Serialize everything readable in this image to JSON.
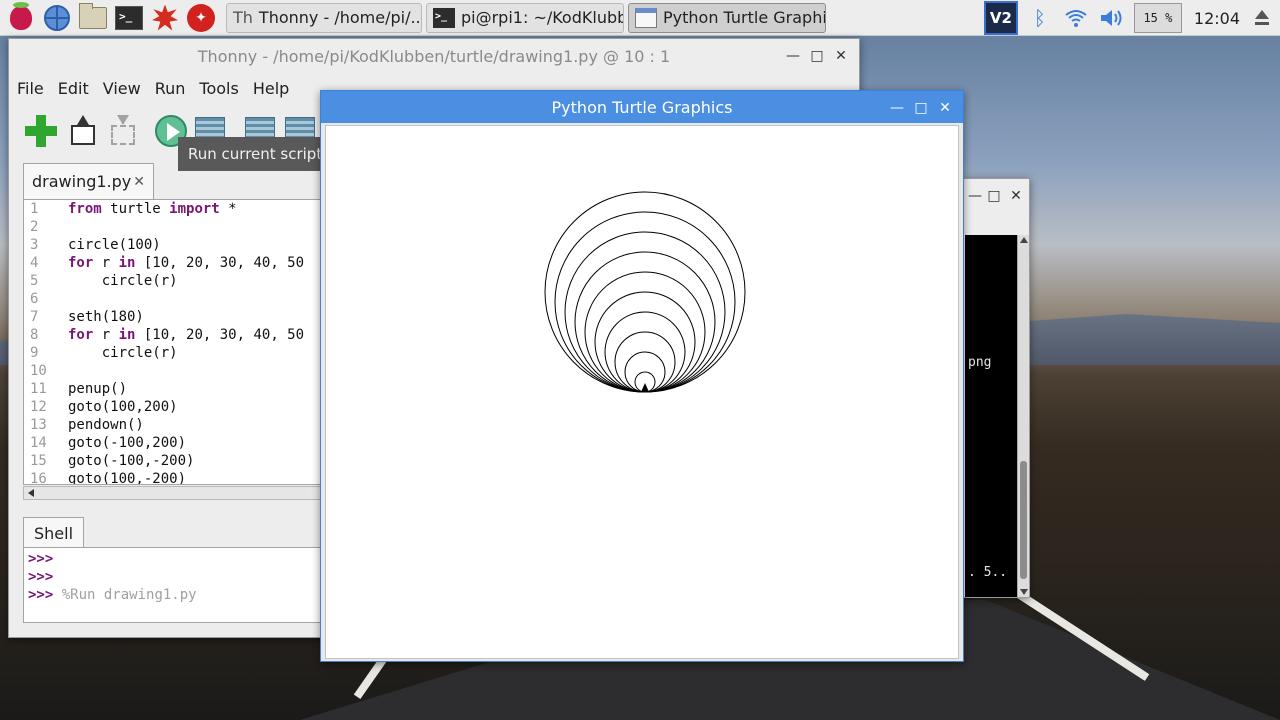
{
  "taskbar": {
    "launchers": [
      "raspberry-menu",
      "web-browser",
      "file-manager",
      "terminal",
      "burst",
      "wolfram"
    ],
    "tasks": [
      {
        "label": "Thonny  -  /home/pi/...",
        "icon": "thonny-icon",
        "active": false
      },
      {
        "label": "pi@rpi1: ~/KodKlubb...",
        "icon": "terminal-icon",
        "active": false
      },
      {
        "label": "Python Turtle Graphics",
        "icon": "window-icon",
        "active": true
      }
    ],
    "tray": {
      "vnc_label": "V2",
      "cpu": "15 %",
      "clock": "12:04"
    }
  },
  "thonny": {
    "title": "Thonny  -  /home/pi/KodKlubben/turtle/drawing1.py  @  10 : 1",
    "menu": [
      "File",
      "Edit",
      "View",
      "Run",
      "Tools",
      "Help"
    ],
    "tooltip": "Run current script",
    "tab": {
      "label": "drawing1.py",
      "close": "✕"
    },
    "lines": [
      {
        "n": "1",
        "parts": [
          [
            "kw",
            "from"
          ],
          [
            "",
            " turtle "
          ],
          [
            "kw",
            "import"
          ],
          [
            "",
            " *"
          ]
        ]
      },
      {
        "n": "2",
        "parts": []
      },
      {
        "n": "3",
        "parts": [
          [
            "",
            "circle(100)"
          ]
        ]
      },
      {
        "n": "4",
        "parts": [
          [
            "kw",
            "for"
          ],
          [
            "",
            " r "
          ],
          [
            "kw",
            "in"
          ],
          [
            "",
            " [10, 20, 30, 40, 50"
          ]
        ]
      },
      {
        "n": "5",
        "parts": [
          [
            "",
            "    circle(r)"
          ]
        ]
      },
      {
        "n": "6",
        "parts": []
      },
      {
        "n": "7",
        "parts": [
          [
            "",
            "seth(180)"
          ]
        ]
      },
      {
        "n": "8",
        "parts": [
          [
            "kw",
            "for"
          ],
          [
            "",
            " r "
          ],
          [
            "kw",
            "in"
          ],
          [
            "",
            " [10, 20, 30, 40, 50"
          ]
        ]
      },
      {
        "n": "9",
        "parts": [
          [
            "",
            "    circle(r)"
          ]
        ]
      },
      {
        "n": "10",
        "parts": []
      },
      {
        "n": "11",
        "parts": [
          [
            "",
            "penup()"
          ]
        ]
      },
      {
        "n": "12",
        "parts": [
          [
            "",
            "goto(100,200)"
          ]
        ]
      },
      {
        "n": "13",
        "parts": [
          [
            "",
            "pendown()"
          ]
        ]
      },
      {
        "n": "14",
        "parts": [
          [
            "",
            "goto(-100,200)"
          ]
        ]
      },
      {
        "n": "15",
        "parts": [
          [
            "",
            "goto(-100,-200)"
          ]
        ]
      },
      {
        "n": "16",
        "parts": [
          [
            "",
            "goto(100,-200)"
          ]
        ]
      }
    ],
    "shell": {
      "tab": "Shell",
      "prompt": ">>>",
      "command": "%Run drawing1.py"
    }
  },
  "terminal": {
    "line_a": "png",
    "line_b": ". 5.."
  },
  "turtle": {
    "title": "Python Turtle Graphics",
    "circle_radii": [
      100,
      90,
      80,
      70,
      60,
      50,
      40,
      30,
      20,
      10
    ],
    "colors": {
      "stroke": "#000000",
      "background": "#ffffff"
    }
  },
  "colors": {
    "accent_titlebar": "#4b8fe3",
    "keyword": "#7a1575"
  }
}
